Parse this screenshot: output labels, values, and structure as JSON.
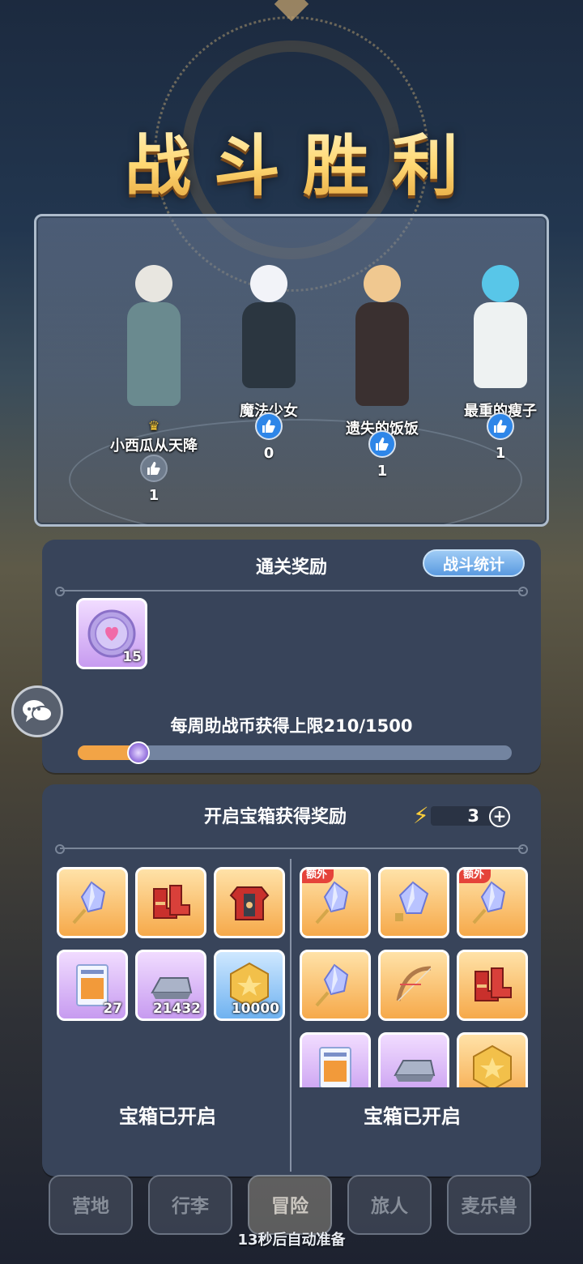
{
  "title": "战斗胜利",
  "heroes": [
    {
      "name": "小西瓜从天降",
      "mvp": true,
      "likes": "1",
      "liked": false,
      "hair": "#e8e6e0",
      "outfit": "#6a8a8f"
    },
    {
      "name": "魔法少女",
      "mvp": false,
      "likes": "0",
      "liked": true,
      "hair": "#f2f3f8",
      "outfit": "#2b3640"
    },
    {
      "name": "遗失的饭饭",
      "mvp": false,
      "likes": "1",
      "liked": true,
      "hair": "#f0c890",
      "outfit": "#3a3030"
    },
    {
      "name": "最重的瘦子",
      "mvp": false,
      "likes": "1",
      "liked": true,
      "hair": "#58c6e8",
      "outfit": "#eef2f2"
    }
  ],
  "clear_rewards": {
    "title": "通关奖励",
    "stats_button": "战斗统计",
    "items": [
      {
        "icon": "assist-coin-icon",
        "qty": "15",
        "rarity": "purple"
      }
    ],
    "weekly_cap_label": "每周助战币获得上限210/1500",
    "weekly_progress": 0.14
  },
  "chest_rewards": {
    "title": "开启宝箱获得奖励",
    "energy": "3",
    "extra_tag": "额外",
    "opened_label_left": "宝箱已开启",
    "opened_label_right": "宝箱已开启",
    "left_items": [
      {
        "icon": "crystal-sword-icon",
        "rarity": "orange",
        "qty": "",
        "extra": false
      },
      {
        "icon": "red-boots-icon",
        "rarity": "orange",
        "qty": "",
        "extra": false
      },
      {
        "icon": "red-armor-icon",
        "rarity": "orange",
        "qty": "",
        "extra": false
      },
      {
        "icon": "ticket-icon",
        "rarity": "purple",
        "qty": "27",
        "extra": false
      },
      {
        "icon": "iron-ingot-icon",
        "rarity": "purple",
        "qty": "21432",
        "extra": false
      },
      {
        "icon": "gold-coin-icon",
        "rarity": "blue",
        "qty": "10000",
        "extra": false
      }
    ],
    "right_items": [
      {
        "icon": "crystal-sword-icon",
        "rarity": "orange",
        "qty": "",
        "extra": true
      },
      {
        "icon": "crystal-shard-icon",
        "rarity": "orange",
        "qty": "",
        "extra": false
      },
      {
        "icon": "crystal-sword-icon",
        "rarity": "orange",
        "qty": "",
        "extra": true
      },
      {
        "icon": "crystal-sword-icon",
        "rarity": "orange",
        "qty": "",
        "extra": false
      },
      {
        "icon": "bow-icon",
        "rarity": "orange",
        "qty": "",
        "extra": false
      },
      {
        "icon": "red-boots-icon",
        "rarity": "orange",
        "qty": "",
        "extra": false
      },
      {
        "icon": "ticket-icon",
        "rarity": "purple",
        "qty": "",
        "extra": false
      },
      {
        "icon": "iron-ingot-icon",
        "rarity": "purple",
        "qty": "",
        "extra": false
      },
      {
        "icon": "gold-coin-icon",
        "rarity": "orange",
        "qty": "",
        "extra": false
      }
    ]
  },
  "nav": {
    "tabs": [
      "营地",
      "行李",
      "冒险",
      "旅人",
      "麦乐兽"
    ],
    "active": 2
  },
  "auto_ready": "13秒后自动准备"
}
